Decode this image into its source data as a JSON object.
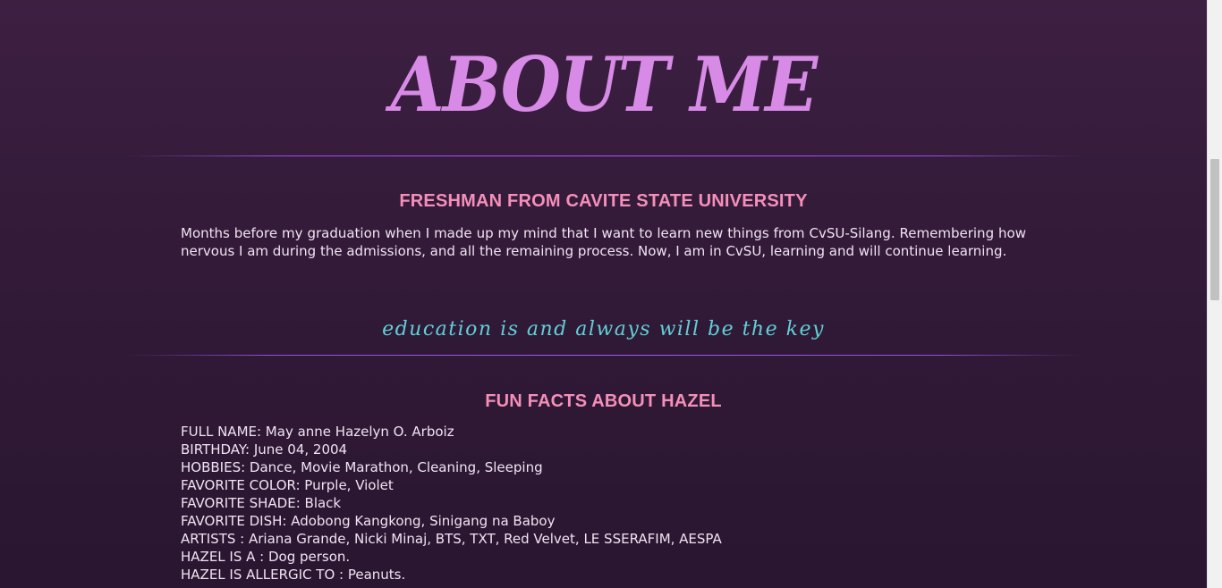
{
  "about": {
    "title": "ABOUT ME",
    "heading": "FRESHMAN FROM CAVITE STATE UNIVERSITY",
    "paragraph": "Months before my graduation when I made up my mind that I want to learn new things from CvSU-Silang. Remembering how nervous I am during the admissions, and all the remaining process. Now, I am in CvSU, learning and will continue learning."
  },
  "tagline": "education is and always will be the key",
  "fun_facts": {
    "heading": "FUN FACTS ABOUT HAZEL",
    "items": [
      "FULL NAME: May anne Hazelyn O. Arboiz",
      "BIRTHDAY: June 04, 2004",
      "HOBBIES: Dance, Movie Marathon, Cleaning, Sleeping",
      "FAVORITE COLOR: Purple, Violet",
      "FAVORITE SHADE: Black",
      "FAVORITE DISH: Adobong Kangkong, Sinigang na Baboy",
      "ARTISTS : Ariana Grande, Nicki Minaj, BTS, TXT, Red Velvet, LE SSERAFIM, AESPA",
      "HAZEL IS A : Dog person.",
      "HAZEL IS ALLERGIC TO : Peanuts."
    ]
  },
  "colors": {
    "background": "#3d1f42",
    "title": "#d88be6",
    "heading": "#f48fb8",
    "tagline": "#5fd0d6",
    "divider": "#a855f7"
  }
}
